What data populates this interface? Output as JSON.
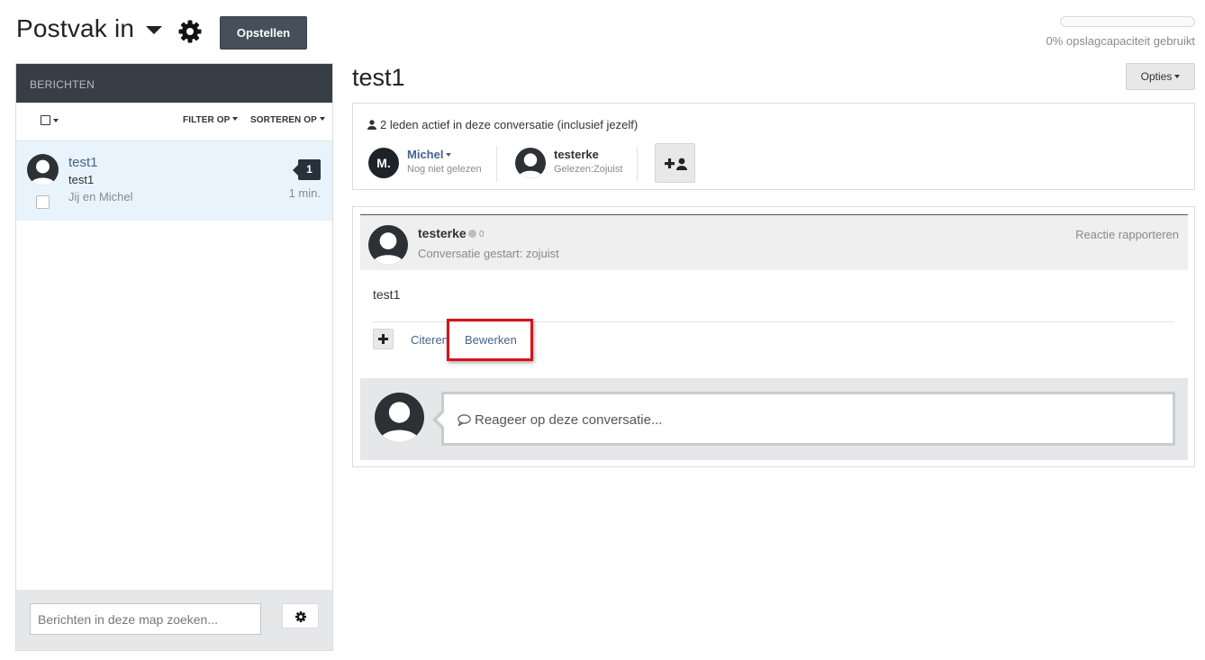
{
  "header": {
    "title": "Postvak in",
    "compose_label": "Opstellen",
    "storage_text": "0% opslagcapaciteit gebruikt",
    "storage_fraction": 0.0
  },
  "sidebar": {
    "header": "BERICHTEN",
    "filter_label": "FILTER OP",
    "sort_label": "SORTEREN OP",
    "conversations": [
      {
        "title": "test1",
        "preview": "test1",
        "members": "Jij en Michel",
        "unread": "1",
        "time": "1 min."
      }
    ],
    "search_placeholder": "Berichten in deze map zoeken..."
  },
  "conversation": {
    "title": "test1",
    "options_label": "Opties",
    "members_info": "2 leden actief in deze conversatie (inclusief jezelf)",
    "members": [
      {
        "initials": "M.",
        "name": "Michel",
        "status": "Nog niet gelezen"
      },
      {
        "name": "testerke",
        "status": "Gelezen:Zojuist"
      }
    ],
    "message": {
      "author": "testerke",
      "score": "0",
      "started": "Conversatie gestart: zojuist",
      "report_label": "Reactie rapporteren",
      "body": "test1",
      "quote_label": "Citeren",
      "edit_label": "Bewerken"
    },
    "reply_placeholder": "Reageer op deze conversatie..."
  },
  "colors": {
    "accent_link": "#46638d",
    "dark_header": "#383e45",
    "highlight_border": "#d9131a",
    "selected_row": "#e9f3fb"
  },
  "icons": [
    "chevron-down-icon",
    "gear-icon",
    "user-icon",
    "add-user-icon",
    "plus-icon",
    "comment-icon"
  ]
}
